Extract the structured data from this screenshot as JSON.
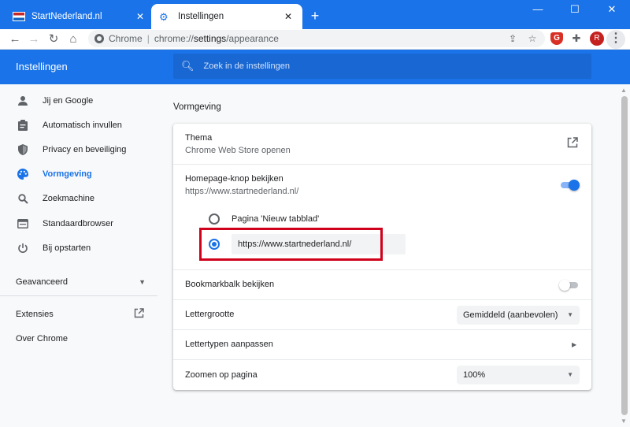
{
  "browser": {
    "tabs": [
      {
        "title": "StartNederland.nl",
        "active": false
      },
      {
        "title": "Instellingen",
        "active": true
      }
    ],
    "new_tab": "+",
    "window_controls": {
      "minimize": "—",
      "maximize": "☐",
      "close": "✕"
    },
    "omnibox": {
      "chrome_label": "Chrome",
      "separator": "|",
      "scheme": "chrome://",
      "host": "settings",
      "path": "/appearance"
    },
    "avatar_initial": "R",
    "ext_shield_letter": "G"
  },
  "header": {
    "title": "Instellingen",
    "search_placeholder": "Zoek in de instellingen"
  },
  "sidebar": {
    "items": [
      {
        "label": "Jij en Google",
        "icon": "person-icon"
      },
      {
        "label": "Automatisch invullen",
        "icon": "clipboard-icon"
      },
      {
        "label": "Privacy en beveiliging",
        "icon": "shield-icon"
      },
      {
        "label": "Vormgeving",
        "icon": "palette-icon",
        "active": true
      },
      {
        "label": "Zoekmachine",
        "icon": "search-icon"
      },
      {
        "label": "Standaardbrowser",
        "icon": "browser-icon"
      },
      {
        "label": "Bij opstarten",
        "icon": "power-icon"
      }
    ],
    "advanced": "Geavanceerd",
    "extensions": "Extensies",
    "about": "Over Chrome"
  },
  "main": {
    "section_title": "Vormgeving",
    "theme": {
      "label": "Thema",
      "sub": "Chrome Web Store openen"
    },
    "homepage": {
      "label": "Homepage-knop bekijken",
      "sub": "https://www.startnederland.nl/",
      "enabled": true,
      "option_newtab": "Pagina 'Nieuw tabblad'",
      "option_custom_value": "https://www.startnederland.nl/",
      "selected": "custom"
    },
    "bookmarks": {
      "label": "Bookmarkbalk bekijken",
      "enabled": false
    },
    "font_size": {
      "label": "Lettergrootte",
      "value": "Gemiddeld (aanbevolen)"
    },
    "fonts": {
      "label": "Lettertypen aanpassen"
    },
    "zoom": {
      "label": "Zoomen op pagina",
      "value": "100%"
    }
  },
  "colors": {
    "accent": "#1a73e8",
    "highlight": "#d0021b"
  }
}
